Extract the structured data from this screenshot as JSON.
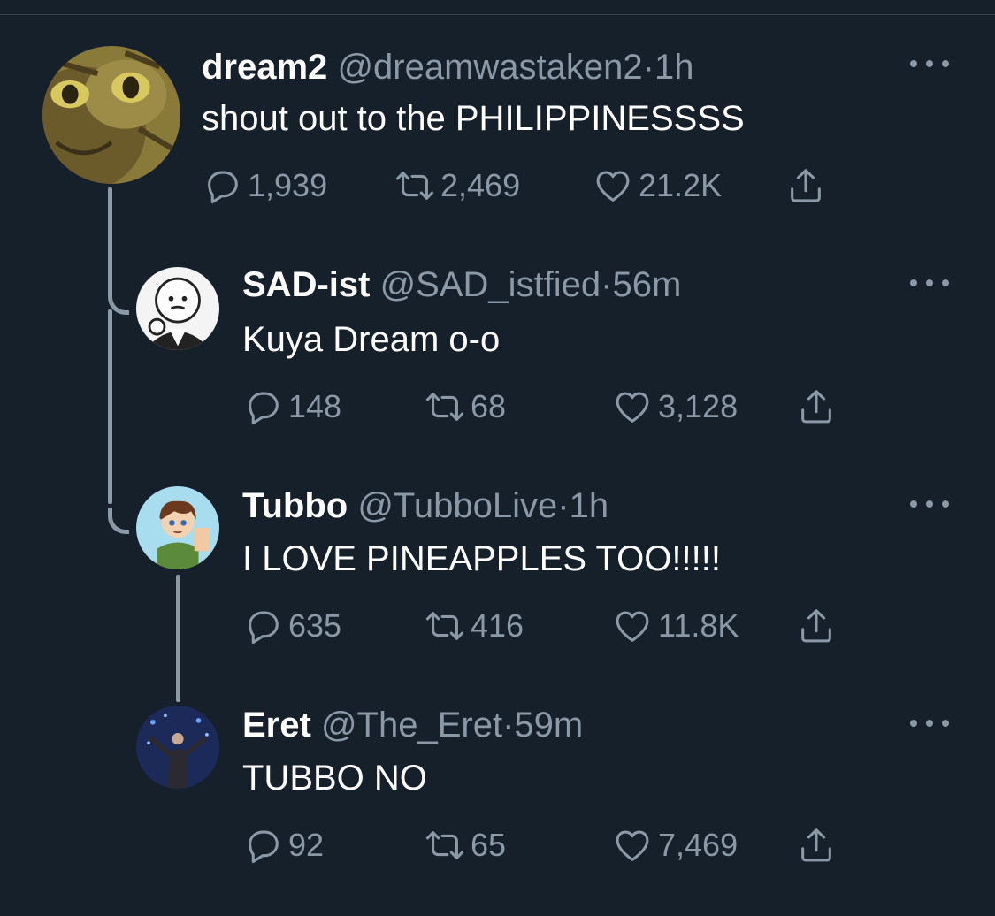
{
  "tweets": [
    {
      "name": "dream2",
      "handle": "@dreamwastaken2",
      "separator": "·",
      "time": "1h",
      "text": "shout out to the PHILIPPINESSSS",
      "replies": "1,939",
      "retweets": "2,469",
      "likes": "21.2K"
    },
    {
      "name": "SAD-ist",
      "handle": "@SAD_istfied",
      "separator": "·",
      "time": "56m",
      "text": "Kuya Dream o-o",
      "replies": "148",
      "retweets": "68",
      "likes": "3,128"
    },
    {
      "name": "Tubbo",
      "handle": "@TubboLive",
      "separator": "·",
      "time": "1h",
      "text": "I LOVE PINEAPPLES TOO!!!!!",
      "replies": "635",
      "retweets": "416",
      "likes": "11.8K"
    },
    {
      "name": "Eret",
      "handle": "@The_Eret",
      "separator": "·",
      "time": "59m",
      "text": "TUBBO NO",
      "replies": "92",
      "retweets": "65",
      "likes": "7,469"
    }
  ],
  "icons": {
    "reply": "reply-icon",
    "retweet": "retweet-icon",
    "like": "heart-icon",
    "share": "share-icon",
    "more": "more-icon"
  },
  "colors": {
    "background": "#15202b",
    "primary_text": "#ffffff",
    "secondary_text": "#8b98a5",
    "thread_line": "#8b98a5"
  }
}
